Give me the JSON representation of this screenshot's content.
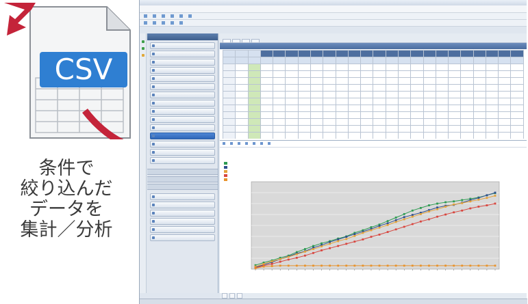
{
  "illustration": {
    "doc_label": "CSV",
    "caption_lines": [
      "条件で",
      "絞り込んだ",
      "データを",
      "集計／分析"
    ],
    "colors": {
      "arrow": "#c4243a",
      "doc_blue": "#2f7fd2",
      "doc_border": "#7a7a7a"
    }
  },
  "app": {
    "title": "",
    "menu": [
      "",
      "",
      "",
      "",
      "",
      "",
      "",
      "",
      "",
      ""
    ],
    "toolbar": [
      "",
      "",
      "",
      "",
      "",
      "",
      "",
      "",
      "",
      "",
      ""
    ],
    "sidebar": {
      "header": "",
      "items": [
        {
          "label": "",
          "active": false
        },
        {
          "label": "",
          "active": false
        },
        {
          "label": "",
          "active": false
        },
        {
          "label": "",
          "active": false
        },
        {
          "label": "",
          "active": false
        },
        {
          "label": "",
          "active": false
        },
        {
          "label": "",
          "active": false
        },
        {
          "label": "",
          "active": false
        },
        {
          "label": "",
          "active": false
        },
        {
          "label": "",
          "active": false
        },
        {
          "label": "",
          "active": false
        },
        {
          "label": "",
          "active": true
        },
        {
          "label": "",
          "active": false
        },
        {
          "label": "",
          "active": false
        },
        {
          "label": "",
          "active": false
        }
      ],
      "sections": [
        "",
        "",
        ""
      ],
      "items2": [
        "",
        "",
        "",
        "",
        "",
        ""
      ]
    },
    "tabs": [
      "",
      "",
      "",
      ""
    ],
    "panel_title": "",
    "grid": {
      "row_headers": [
        "",
        "",
        "",
        "",
        "",
        ""
      ],
      "column_count": 24
    },
    "chart_toolbar": [
      "",
      "",
      "",
      "",
      "",
      "",
      ""
    ],
    "bottom_tabs": [
      "",
      "",
      ""
    ],
    "status": ""
  },
  "chart_data": {
    "type": "line",
    "title": "",
    "subtitle": "",
    "xlabel": "",
    "ylabel": "",
    "series": [
      {
        "color": "#2e9b52",
        "values": [
          0.9,
          1.5,
          2.0,
          2.6,
          3.1,
          3.9,
          4.6,
          5.3,
          5.9,
          6.4,
          7.0,
          7.5,
          8.3,
          8.9,
          9.6,
          10.2,
          11.0,
          11.8,
          12.6,
          13.4,
          14.0,
          14.6,
          15.0,
          15.3,
          15.5,
          15.8,
          16.1,
          16.4,
          16.9,
          17.4
        ]
      },
      {
        "color": "#2f4f8f",
        "values": [
          0.4,
          1.0,
          1.6,
          2.3,
          2.9,
          3.6,
          4.1,
          4.9,
          5.5,
          6.2,
          6.8,
          7.4,
          8.0,
          8.6,
          9.2,
          9.9,
          10.5,
          11.2,
          11.9,
          12.4,
          12.9,
          13.5,
          14.1,
          14.5,
          14.7,
          15.2,
          15.8,
          16.3,
          16.9,
          17.5
        ]
      },
      {
        "color": "#e3a23a",
        "values": [
          0.6,
          1.2,
          1.8,
          2.3,
          2.8,
          3.4,
          4.0,
          4.6,
          5.2,
          5.8,
          6.4,
          6.9,
          7.6,
          8.3,
          8.9,
          9.5,
          10.1,
          10.8,
          11.4,
          12.0,
          12.6,
          13.2,
          13.7,
          14.3,
          14.8,
          15.1,
          15.5,
          15.9,
          16.3,
          16.8
        ]
      },
      {
        "color": "#d8463f",
        "values": [
          0.3,
          0.8,
          1.2,
          1.7,
          2.2,
          2.6,
          3.1,
          3.7,
          4.3,
          4.8,
          5.3,
          5.8,
          6.3,
          6.8,
          7.4,
          7.9,
          8.5,
          9.1,
          9.7,
          10.3,
          10.9,
          11.4,
          12.0,
          12.5,
          13.0,
          13.4,
          13.9,
          14.3,
          14.6,
          15.0
        ]
      },
      {
        "color": "#e8922b",
        "values": [
          0.2,
          0.6,
          0.7,
          0.8,
          0.8,
          0.8,
          0.8,
          0.8,
          0.8,
          0.8,
          0.8,
          0.8,
          0.8,
          0.8,
          0.8,
          0.8,
          0.8,
          0.8,
          0.8,
          0.8,
          0.8,
          0.8,
          0.8,
          0.8,
          0.8,
          0.8,
          0.8,
          0.8,
          0.8,
          0.8
        ]
      }
    ],
    "ylim": [
      0,
      20
    ],
    "grid": true,
    "legend": "left"
  }
}
